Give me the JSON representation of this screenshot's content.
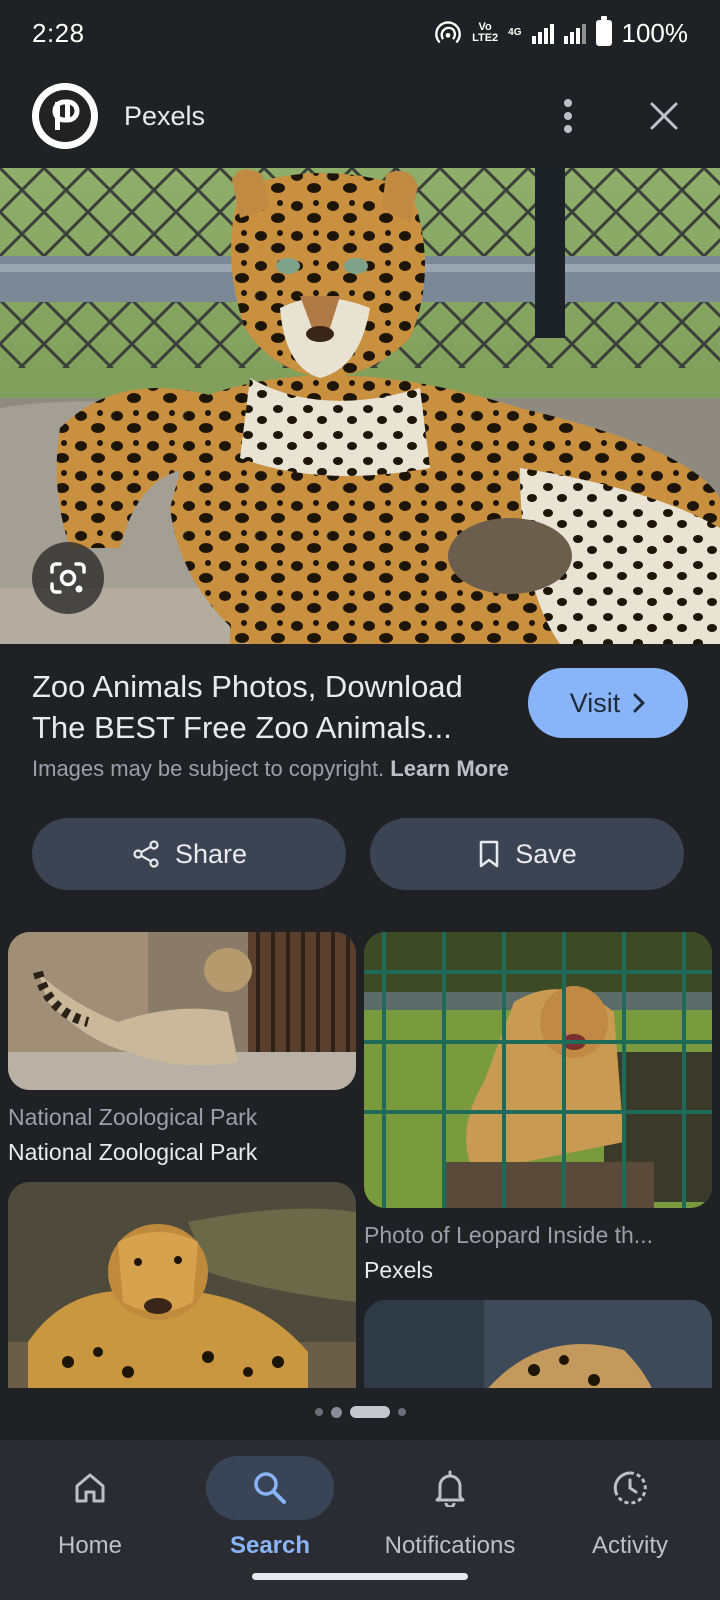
{
  "status_bar": {
    "time": "2:28",
    "network_label": "VoLTE2",
    "network_type": "4G",
    "battery": "100%"
  },
  "header": {
    "title": "Pexels",
    "logo_icon": "pexels-logo-icon",
    "more_icon": "more-vert-icon",
    "close_icon": "close-icon"
  },
  "hero": {
    "image_icon": "leopard-photo",
    "lens_icon": "google-lens-icon"
  },
  "result": {
    "title": "Zoo Animals Photos, Download The BEST Free Zoo Animals...",
    "visit_label": "Visit",
    "copyright_text": "Images may be subject to copyright.",
    "learn_more": "Learn More"
  },
  "actions": {
    "share_label": "Share",
    "save_label": "Save"
  },
  "related": [
    {
      "caption": "National Zoological Park",
      "source": "National Zoological Park"
    },
    {
      "caption": "Photo of Leopard Inside th...",
      "source": "Pexels"
    },
    {
      "caption": "",
      "source": ""
    },
    {
      "caption": "",
      "source": ""
    }
  ],
  "bottom_nav": [
    {
      "label": "Home",
      "icon": "home-icon",
      "active": false
    },
    {
      "label": "Search",
      "icon": "search-icon",
      "active": true
    },
    {
      "label": "Notifications",
      "icon": "bell-icon",
      "active": false
    },
    {
      "label": "Activity",
      "icon": "history-icon",
      "active": false
    }
  ],
  "colors": {
    "background": "#202124",
    "accent": "#8ab4f8",
    "pill": "#3c4453",
    "nav_bg": "#2a2c31"
  }
}
